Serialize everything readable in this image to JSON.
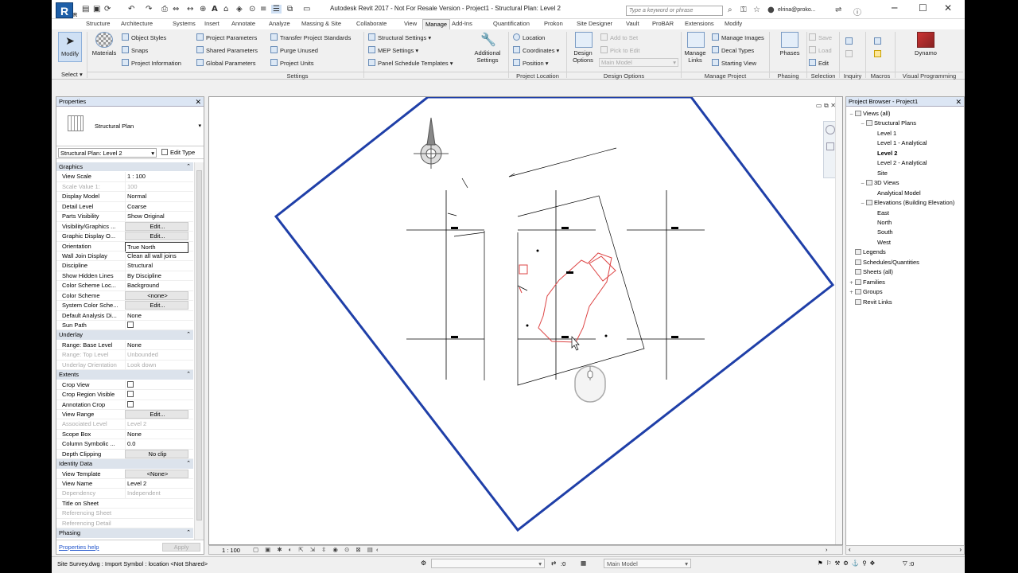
{
  "app": {
    "logo": "R",
    "window_title": "Autodesk Revit 2017 - Not For Resale Version -    Project1 - Structural Plan: Level 2",
    "search_placeholder": "Type a keyword or phrase",
    "user": "elrina@proko...",
    "qat_icons": [
      "open-icon",
      "save-icon",
      "sync-icon",
      "undo-icon",
      "redo-icon",
      "print-icon",
      "measure-icon",
      "dimension-icon",
      "tag-icon",
      "text-icon",
      "3d-view-icon",
      "section-icon",
      "thin-lines-icon",
      "close-hidden-icon",
      "switch-windows-icon"
    ]
  },
  "tabs": [
    {
      "label": "Structure",
      "active": false
    },
    {
      "label": "Architecture",
      "active": false
    },
    {
      "label": "Systems",
      "active": false
    },
    {
      "label": "Insert",
      "active": false
    },
    {
      "label": "Annotate",
      "active": false
    },
    {
      "label": "Analyze",
      "active": false
    },
    {
      "label": "Massing & Site",
      "active": false
    },
    {
      "label": "Collaborate",
      "active": false
    },
    {
      "label": "View",
      "active": false
    },
    {
      "label": "Manage",
      "active": true
    },
    {
      "label": "Add-Ins",
      "active": false
    },
    {
      "label": "Quantification",
      "active": false
    },
    {
      "label": "Prokon",
      "active": false
    },
    {
      "label": "Site Designer",
      "active": false
    },
    {
      "label": "Vault",
      "active": false
    },
    {
      "label": "ProBAR",
      "active": false
    },
    {
      "label": "Extensions",
      "active": false
    },
    {
      "label": "Modify",
      "active": false
    }
  ],
  "ribbon": {
    "modify": "Modify",
    "select": "Select",
    "materials": "Materials",
    "object_styles": "Object Styles",
    "snaps": "Snaps",
    "project_information": "Project Information",
    "project_parameters": "Project Parameters",
    "shared_parameters": "Shared Parameters",
    "global_parameters": "Global Parameters",
    "transfer_project_standards": "Transfer Project Standards",
    "purge_unused": "Purge Unused",
    "project_units": "Project Units",
    "structural_settings": "Structural Settings",
    "mep_settings": "MEP Settings",
    "panel_schedule_templates": "Panel Schedule Templates",
    "additional_settings": "Additional Settings",
    "settings": "Settings",
    "location": "Location",
    "coordinates": "Coordinates",
    "position": "Position",
    "project_location": "Project Location",
    "design_options": "Design Options",
    "add_to_set": "Add to Set",
    "pick_to_edit": "Pick to Edit",
    "main_model": "Main Model",
    "design_options_panel": "Design Options",
    "manage_links": "Manage Links",
    "manage_images": "Manage Images",
    "decal_types": "Decal Types",
    "starting_view": "Starting View",
    "manage_project": "Manage Project",
    "phases": "Phases",
    "phasing": "Phasing",
    "save": "Save",
    "load": "Load",
    "edit": "Edit",
    "selection": "Selection",
    "inquiry": "Inquiry",
    "macros": "Macros",
    "dynamo": "Dynamo",
    "visual_programming": "Visual Programming"
  },
  "properties": {
    "title": "Properties",
    "type_name": "Structural Plan",
    "instance_selector": "Structural Plan: Level 2",
    "edit_type": "Edit Type",
    "groups": [
      {
        "name": "Graphics",
        "rows": [
          {
            "k": "View Scale",
            "v": "1 : 100"
          },
          {
            "k": "Scale Value    1:",
            "v": "100",
            "dis": true
          },
          {
            "k": "Display Model",
            "v": "Normal"
          },
          {
            "k": "Detail Level",
            "v": "Coarse"
          },
          {
            "k": "Parts Visibility",
            "v": "Show Original"
          },
          {
            "k": "Visibility/Graphics ...",
            "v": "Edit...",
            "btn": true
          },
          {
            "k": "Graphic Display O...",
            "v": "Edit...",
            "btn": true
          },
          {
            "k": "Orientation",
            "v": "True North",
            "sel": true
          },
          {
            "k": "Wall Join Display",
            "v": "Clean all wall joins"
          },
          {
            "k": "Discipline",
            "v": "Structural"
          },
          {
            "k": "Show Hidden Lines",
            "v": "By Discipline"
          },
          {
            "k": "Color Scheme Loc...",
            "v": "Background"
          },
          {
            "k": "Color Scheme",
            "v": "<none>",
            "btn": true
          },
          {
            "k": "System Color Sche...",
            "v": "Edit...",
            "btn": true
          },
          {
            "k": "Default Analysis Di...",
            "v": "None"
          },
          {
            "k": "Sun Path",
            "v": "",
            "chk": true
          }
        ]
      },
      {
        "name": "Underlay",
        "rows": [
          {
            "k": "Range: Base Level",
            "v": "None"
          },
          {
            "k": "Range: Top Level",
            "v": "Unbounded",
            "dis": true
          },
          {
            "k": "Underlay Orientation",
            "v": "Look down",
            "dis": true
          }
        ]
      },
      {
        "name": "Extents",
        "rows": [
          {
            "k": "Crop View",
            "v": "",
            "chk": true
          },
          {
            "k": "Crop Region Visible",
            "v": "",
            "chk": true
          },
          {
            "k": "Annotation Crop",
            "v": "",
            "chk": true
          },
          {
            "k": "View Range",
            "v": "Edit...",
            "btn": true
          },
          {
            "k": "Associated Level",
            "v": "Level 2",
            "dis": true
          },
          {
            "k": "Scope Box",
            "v": "None"
          },
          {
            "k": "Column Symbolic ...",
            "v": "0.0"
          },
          {
            "k": "Depth Clipping",
            "v": "No clip",
            "btn": true
          }
        ]
      },
      {
        "name": "Identity Data",
        "rows": [
          {
            "k": "View Template",
            "v": "<None>",
            "btn": true
          },
          {
            "k": "View Name",
            "v": "Level 2"
          },
          {
            "k": "Dependency",
            "v": "Independent",
            "dis": true
          },
          {
            "k": "Title on Sheet",
            "v": ""
          },
          {
            "k": "Referencing Sheet",
            "v": "",
            "dis": true
          },
          {
            "k": "Referencing Detail",
            "v": "",
            "dis": true
          }
        ]
      },
      {
        "name": "Phasing",
        "rows": []
      }
    ],
    "help": "Properties help",
    "apply": "Apply"
  },
  "view": {
    "scale": "1 : 100"
  },
  "browser": {
    "title": "Project Browser - Project1",
    "nodes": [
      {
        "label": "Views (all)",
        "indent": 0,
        "exp": "−"
      },
      {
        "label": "Structural Plans",
        "indent": 1,
        "exp": "−"
      },
      {
        "label": "Level 1",
        "indent": 2
      },
      {
        "label": "Level 1 - Analytical",
        "indent": 2
      },
      {
        "label": "Level 2",
        "indent": 2,
        "bold": true
      },
      {
        "label": "Level 2 - Analytical",
        "indent": 2
      },
      {
        "label": "Site",
        "indent": 2
      },
      {
        "label": "3D Views",
        "indent": 1,
        "exp": "−"
      },
      {
        "label": "Analytical Model",
        "indent": 2
      },
      {
        "label": "Elevations (Building Elevation)",
        "indent": 1,
        "exp": "−"
      },
      {
        "label": "East",
        "indent": 2
      },
      {
        "label": "North",
        "indent": 2
      },
      {
        "label": "South",
        "indent": 2
      },
      {
        "label": "West",
        "indent": 2
      },
      {
        "label": "Legends",
        "indent": 0
      },
      {
        "label": "Schedules/Quantities",
        "indent": 0
      },
      {
        "label": "Sheets (all)",
        "indent": 0
      },
      {
        "label": "Families",
        "indent": 0,
        "exp": "+"
      },
      {
        "label": "Groups",
        "indent": 0,
        "exp": "+"
      },
      {
        "label": "Revit Links",
        "indent": 0
      }
    ]
  },
  "status": {
    "message": "Site Survey.dwg : Import Symbol : location <Not Shared>",
    "zero": ":0",
    "model": "Main Model",
    "filter_count": ":0"
  }
}
